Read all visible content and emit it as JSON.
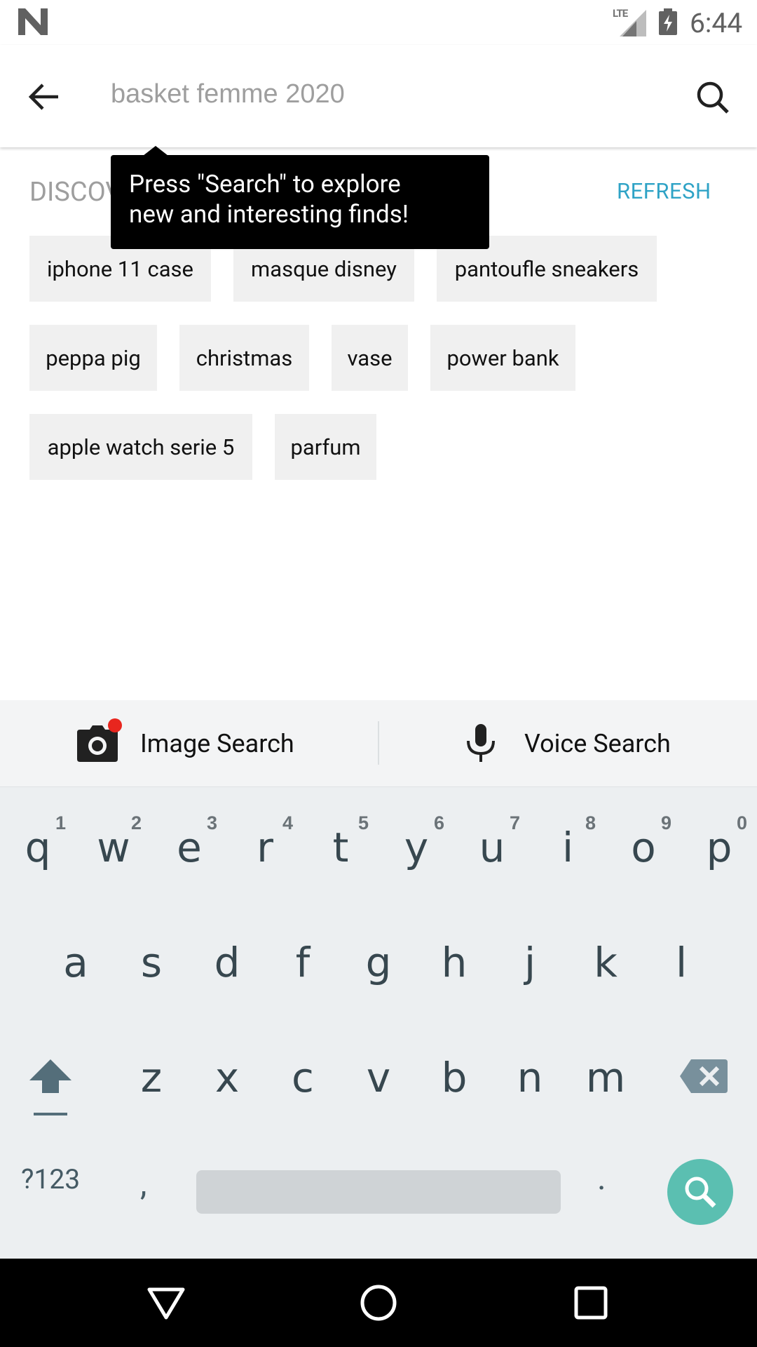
{
  "status_bar": {
    "network_label": "LTE",
    "time": "6:44"
  },
  "search": {
    "placeholder": "basket femme 2020"
  },
  "discover": {
    "title": "DISCOVER",
    "refresh_label": "REFRESH",
    "chips": [
      "iphone 11 case",
      "masque disney",
      "pantoufle sneakers",
      "peppa pig",
      "christmas",
      "vase",
      "power bank",
      "apple watch serie 5",
      "parfum"
    ]
  },
  "tooltip": {
    "line1": "Press \"Search\" to explore",
    "line2": "new and interesting finds!"
  },
  "keyboard": {
    "toolbar": {
      "image_search_label": "Image Search",
      "voice_search_label": "Voice Search"
    },
    "row1": [
      {
        "key": "q",
        "hint": "1"
      },
      {
        "key": "w",
        "hint": "2"
      },
      {
        "key": "e",
        "hint": "3"
      },
      {
        "key": "r",
        "hint": "4"
      },
      {
        "key": "t",
        "hint": "5"
      },
      {
        "key": "y",
        "hint": "6"
      },
      {
        "key": "u",
        "hint": "7"
      },
      {
        "key": "i",
        "hint": "8"
      },
      {
        "key": "o",
        "hint": "9"
      },
      {
        "key": "p",
        "hint": "0"
      }
    ],
    "row2": [
      "a",
      "s",
      "d",
      "f",
      "g",
      "h",
      "j",
      "k",
      "l"
    ],
    "row3": [
      "z",
      "x",
      "c",
      "v",
      "b",
      "n",
      "m"
    ],
    "symbols_label": "?123",
    "comma_label": ",",
    "period_label": "."
  },
  "colors": {
    "accent": "#2fa3c6",
    "enter_key": "#5bbfb1",
    "notification_dot": "#e8261e"
  }
}
